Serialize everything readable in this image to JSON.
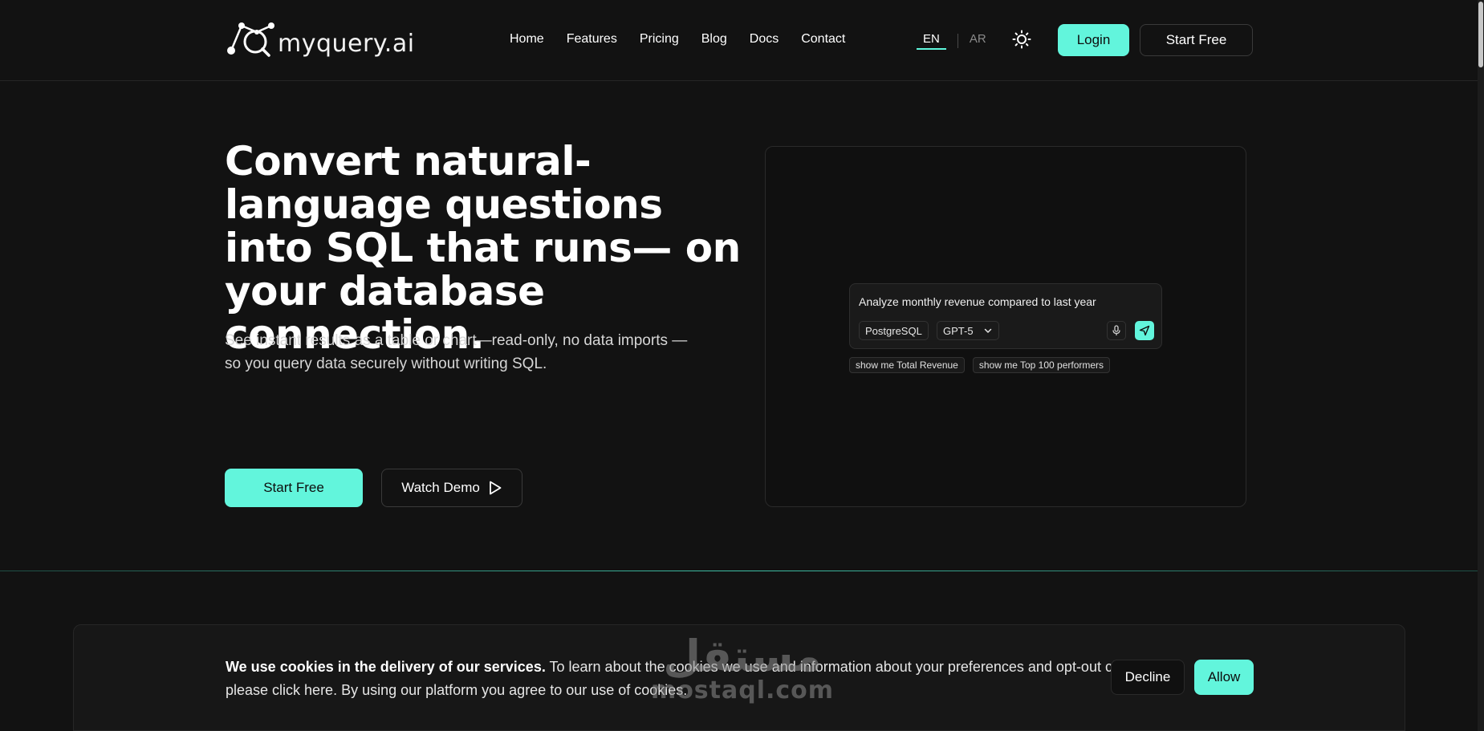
{
  "header": {
    "logo_text": "myquery.ai",
    "nav": [
      {
        "label": "Home"
      },
      {
        "label": "Features"
      },
      {
        "label": "Pricing"
      },
      {
        "label": "Blog"
      },
      {
        "label": "Docs"
      },
      {
        "label": "Contact"
      }
    ],
    "lang_active": "EN",
    "lang_other": "AR",
    "theme_icon": "sun-icon",
    "login_label": "Login",
    "start_label": "Start Free"
  },
  "hero": {
    "title": "Convert natural-language questions into SQL that runs— on your database connection.",
    "subtitle": "See instant results as a table or chart—read-only, no data imports —so you query data securely without writing SQL.",
    "start_label": "Start Free",
    "demo_label": "Watch Demo",
    "demo_icon": "play-icon"
  },
  "demo": {
    "query": "Analyze monthly revenue compared to last year",
    "database": "PostgreSQL",
    "model": "GPT-5",
    "mic_icon": "microphone-icon",
    "send_icon": "send-icon",
    "suggestions": [
      {
        "label": "show me Total Revenue"
      },
      {
        "label": "show me Top 100 performers"
      }
    ]
  },
  "cookie": {
    "bold": "We use cookies in the delivery of our services.",
    "text": " To learn about the cookies we use and information about your preferences and opt-out choices, please click here. By using our platform you agree to our use of cookies.",
    "decline_label": "Decline",
    "allow_label": "Allow"
  },
  "watermark": {
    "top": "مستقل",
    "bottom": "mostaql.com"
  },
  "colors": {
    "accent": "#62f5dc",
    "background": "#121212"
  }
}
